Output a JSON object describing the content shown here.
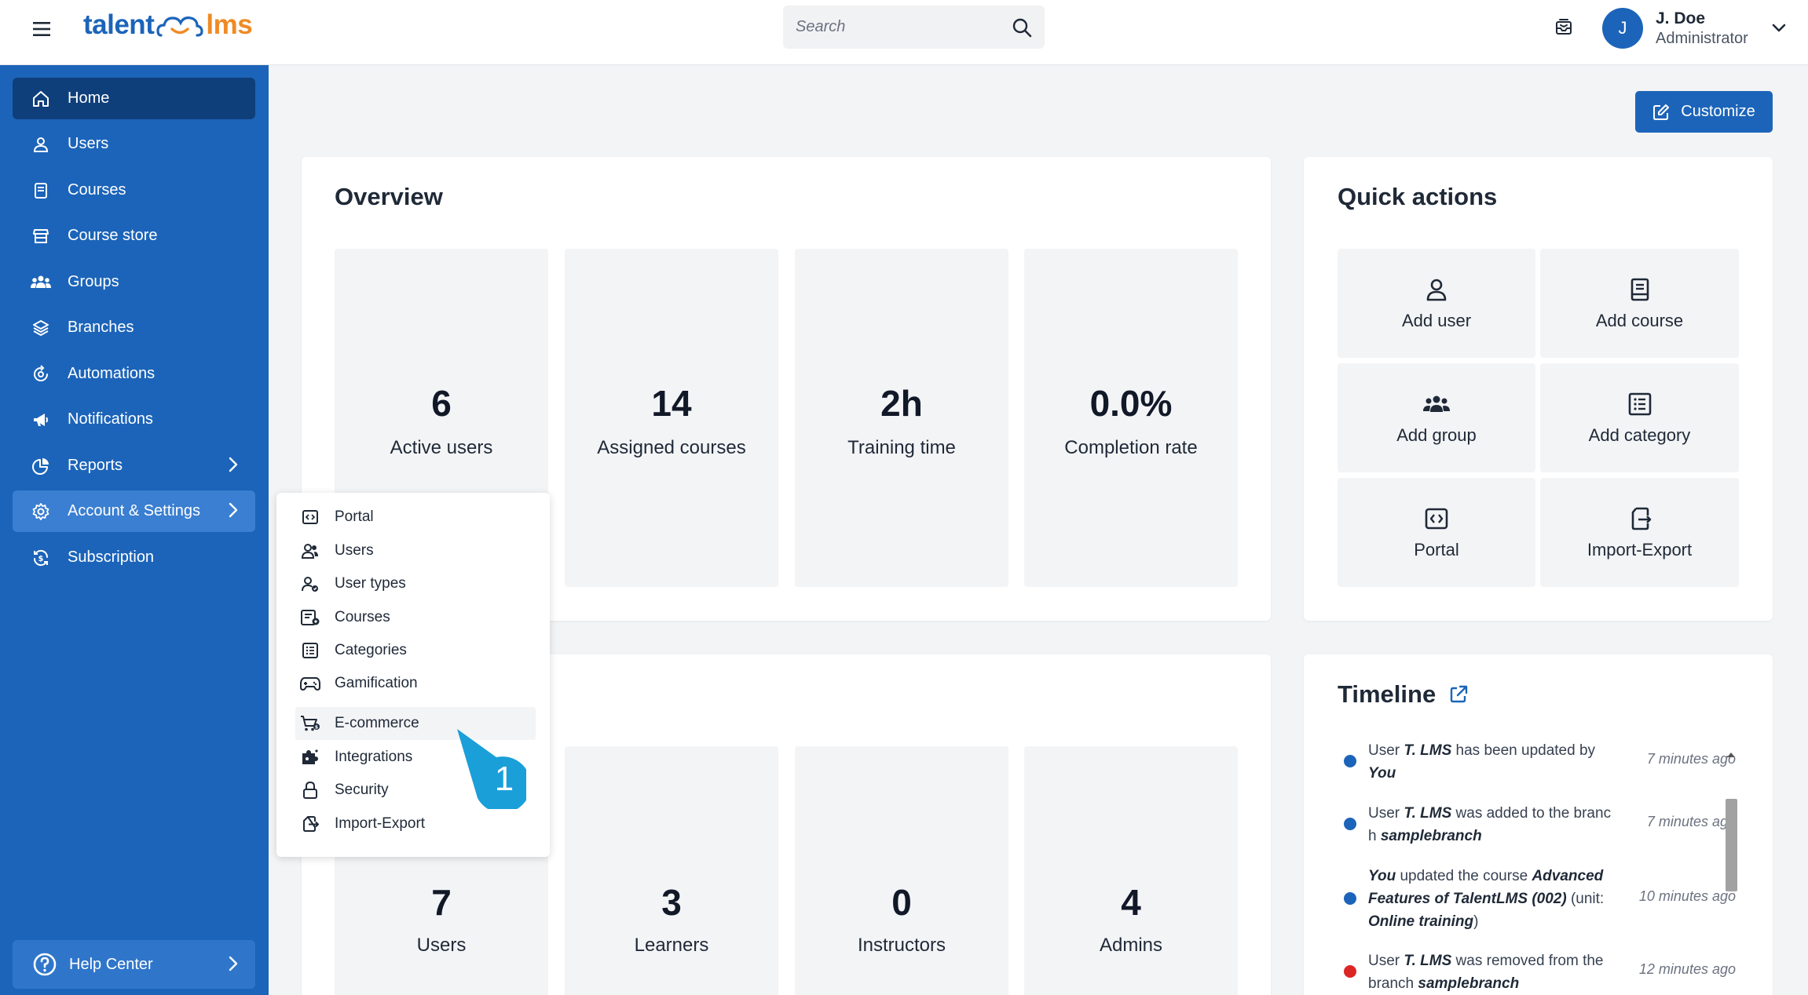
{
  "header": {
    "logo": {
      "part1": "talent",
      "part2": "lms"
    },
    "search_placeholder": "Search",
    "user": {
      "initial": "J",
      "name": "J. Doe",
      "role": "Administrator"
    }
  },
  "sidebar": {
    "items": [
      {
        "label": "Home",
        "icon": "home-icon"
      },
      {
        "label": "Users",
        "icon": "user-icon"
      },
      {
        "label": "Courses",
        "icon": "book-icon"
      },
      {
        "label": "Course store",
        "icon": "store-icon"
      },
      {
        "label": "Groups",
        "icon": "group-icon"
      },
      {
        "label": "Branches",
        "icon": "layers-icon"
      },
      {
        "label": "Automations",
        "icon": "automation-icon"
      },
      {
        "label": "Notifications",
        "icon": "megaphone-icon"
      },
      {
        "label": "Reports",
        "icon": "pie-chart-icon"
      },
      {
        "label": "Account & Settings",
        "icon": "gear-icon"
      },
      {
        "label": "Subscription",
        "icon": "refresh-dollar-icon"
      }
    ],
    "help": "Help Center"
  },
  "toolbar": {
    "customize_label": "Customize"
  },
  "overview": {
    "title": "Overview",
    "stats": [
      {
        "value": "6",
        "label": "Active users"
      },
      {
        "value": "14",
        "label": "Assigned courses"
      },
      {
        "value": "2h",
        "label": "Training time"
      },
      {
        "value": "0.0%",
        "label": "Completion rate"
      }
    ]
  },
  "quick_actions": {
    "title": "Quick actions",
    "items": [
      {
        "label": "Add user",
        "icon": "user-icon"
      },
      {
        "label": "Add course",
        "icon": "book-icon"
      },
      {
        "label": "Add group",
        "icon": "group-icon"
      },
      {
        "label": "Add category",
        "icon": "list-icon"
      },
      {
        "label": "Portal",
        "icon": "code-icon"
      },
      {
        "label": "Import-Export",
        "icon": "import-export-icon"
      }
    ]
  },
  "users_stats": [
    {
      "value": "7",
      "label": "Users"
    },
    {
      "value": "3",
      "label": "Learners"
    },
    {
      "value": "0",
      "label": "Instructors"
    },
    {
      "value": "4",
      "label": "Admins"
    }
  ],
  "account_menu": {
    "items": [
      {
        "label": "Portal",
        "icon": "code-icon"
      },
      {
        "label": "Users",
        "icon": "users-icon"
      },
      {
        "label": "User types",
        "icon": "user-types-icon"
      },
      {
        "label": "Courses",
        "icon": "courses-settings-icon"
      },
      {
        "label": "Categories",
        "icon": "list-icon"
      },
      {
        "label": "Gamification",
        "icon": "gamepad-icon"
      },
      {
        "label": "E-commerce",
        "icon": "cart-icon"
      },
      {
        "label": "Integrations",
        "icon": "puzzle-icon"
      },
      {
        "label": "Security",
        "icon": "lock-icon"
      },
      {
        "label": "Import-Export",
        "icon": "import-export-icon"
      }
    ],
    "callout_number": "1"
  },
  "timeline": {
    "title": "Timeline",
    "items": [
      {
        "pre": "User ",
        "b1": "T. LMS",
        "mid": " has been updated by ",
        "b2": "You",
        "post": "",
        "time": "7 minutes ago",
        "color": "#1c64b9"
      },
      {
        "pre": "User ",
        "b1": "T. LMS",
        "mid": " was added to the branch ",
        "b2": "samplebranch",
        "post": "",
        "time": "7 minutes ago",
        "color": "#1c64b9"
      },
      {
        "pre": "",
        "b1": "You",
        "mid": " updated the course ",
        "b2": "Advanced Features of TalentLMS (002)",
        "post": " (unit: ",
        "b3": "Online training",
        "post2": ")",
        "time": "10 minutes ago",
        "color": "#1c64b9"
      },
      {
        "pre": "User ",
        "b1": "T. LMS",
        "mid": " was removed from the branch ",
        "b2": "samplebranch",
        "post": "",
        "time": "12 minutes ago",
        "color": "#dc2626"
      }
    ]
  },
  "colors": {
    "brand_blue": "#1c64b9",
    "sidebar_active": "#0f3f7a",
    "logo_orange": "#f08a24"
  }
}
